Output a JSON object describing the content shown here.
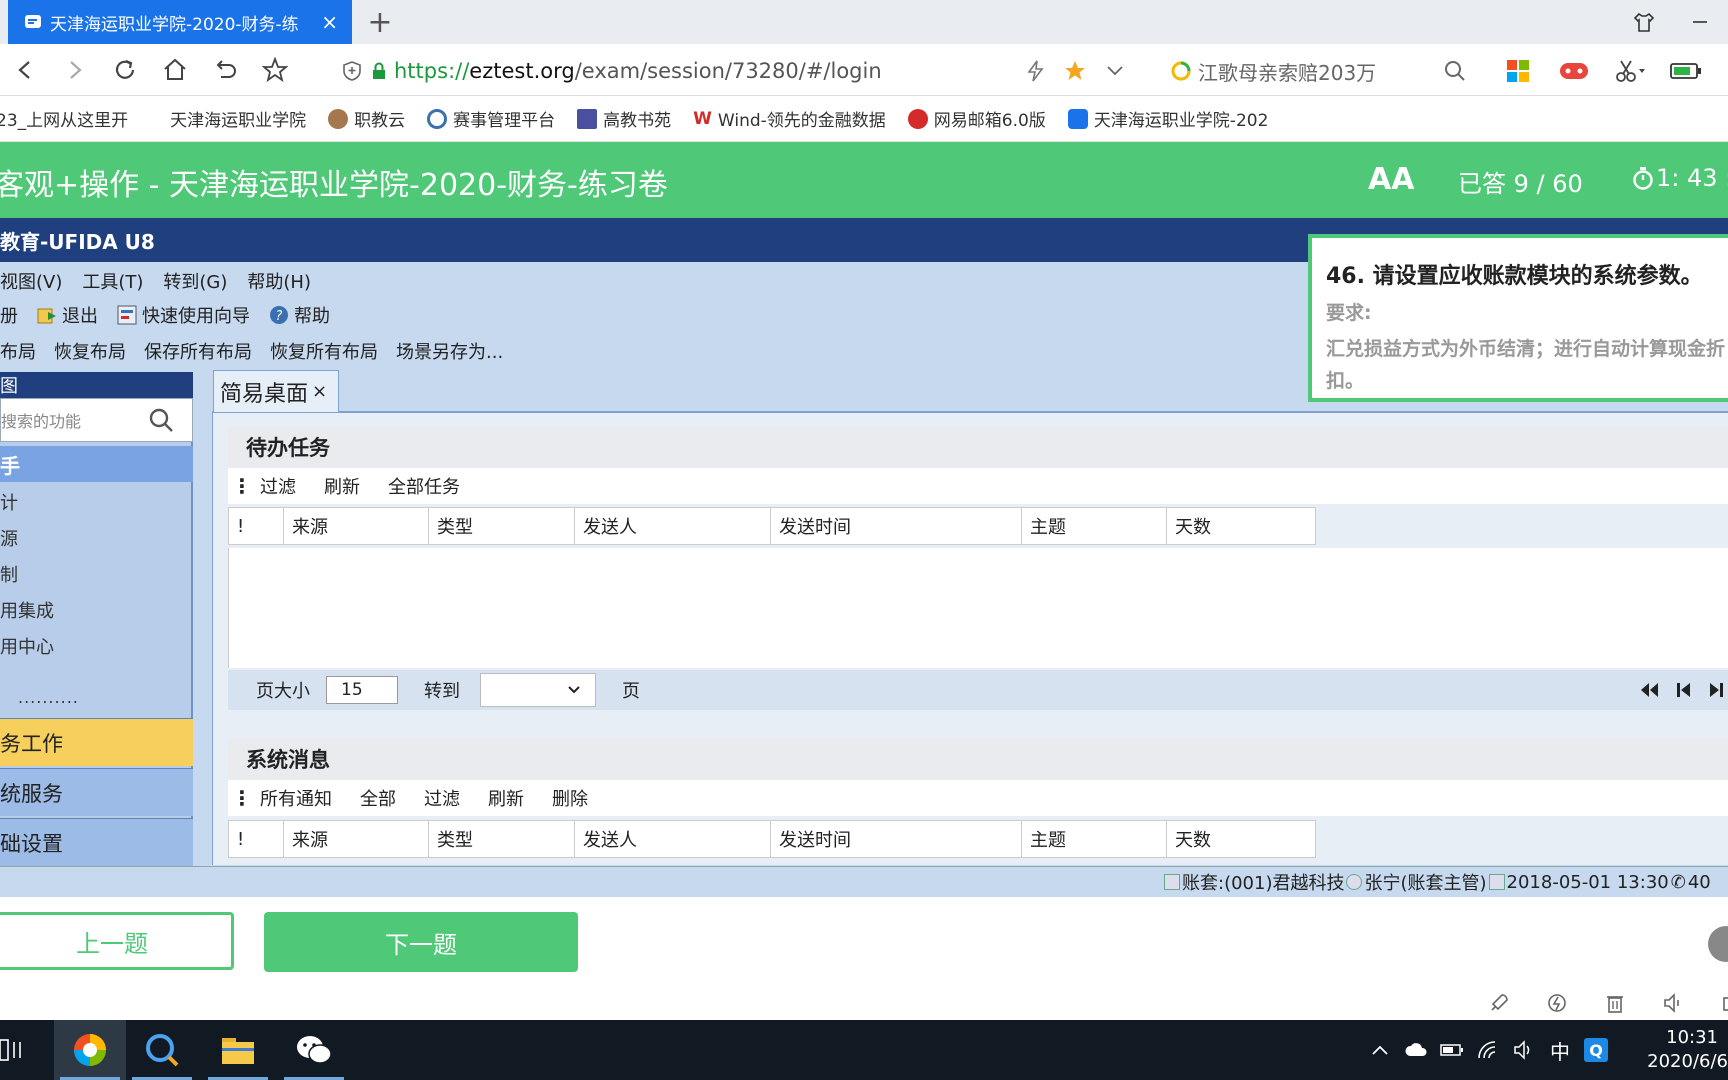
{
  "browser": {
    "active_tab_title": "天津海运职业学院-2020-财务-练",
    "url_https": "https",
    "url_sep": "://",
    "url_host": "eztest.org",
    "url_path": "/exam/session/73280/#/login",
    "search_text": "江歌母亲索赔203万",
    "bookmarks": [
      "23_上网从这里开",
      "天津海运职业学院",
      "职教云",
      "赛事管理平台",
      "高教书苑",
      "Wind-领先的金融数据",
      "网易邮箱6.0版",
      "天津海运职业学院-202"
    ]
  },
  "exam": {
    "title": "客观+操作 - 天津海运职业学院-2020-财务-练习卷",
    "font_toggle": "AA",
    "answered": "已答 9 / 60",
    "timer": "1: 43 :",
    "prev_label": "上一题",
    "next_label": "下一题"
  },
  "question": {
    "title": "46. 请设置应收账款模块的系统参数。",
    "requirement_label": "要求:",
    "text": "汇兑损益方式为外币结清；进行自动计算现金折扣。"
  },
  "u8": {
    "title": "教育-UFIDA U8",
    "menu": [
      "视图(V)",
      "工具(T)",
      "转到(G)",
      "帮助(H)"
    ],
    "toolbar": [
      "册",
      "退出",
      "快速使用向导",
      "帮助"
    ],
    "layout_actions": [
      "布局",
      "恢复布局",
      "保存所有布局",
      "恢复所有布局",
      "场景另存为..."
    ],
    "sidebar": {
      "header": "图",
      "search_placeholder": "搜索的功能",
      "selected": "手",
      "items": [
        "计",
        "源",
        "制",
        "用集成",
        "用中心"
      ],
      "dots": "..........",
      "categories": [
        "务工作",
        "统服务",
        "础设置"
      ]
    },
    "main_tab": "简易桌面",
    "todo": {
      "title": "待办任务",
      "ops": [
        "过滤",
        "刷新",
        "全部任务"
      ],
      "columns": [
        "!",
        "来源",
        "类型",
        "发送人",
        "发送时间",
        "主题",
        "天数"
      ]
    },
    "pager": {
      "page_size_label": "页大小",
      "page_size": "15",
      "goto_label": "转到",
      "page_label": "页"
    },
    "messages": {
      "title": "系统消息",
      "ops": [
        "所有通知",
        "全部",
        "过滤",
        "刷新",
        "删除"
      ],
      "columns": [
        "!",
        "来源",
        "类型",
        "发送人",
        "发送时间",
        "主题",
        "天数"
      ]
    },
    "status": {
      "account": "账套:(001)君越科技",
      "user": "张宁(账套主管)",
      "datetime": "2018-05-01 13:30",
      "phone": "40"
    }
  },
  "taskbar": {
    "time": "10:31",
    "date": "2020/6/6",
    "ime": "中",
    "colors": {
      "accent": "#4fc978",
      "u8_title": "#1f3f7f",
      "taskbar": "#111a22"
    }
  }
}
